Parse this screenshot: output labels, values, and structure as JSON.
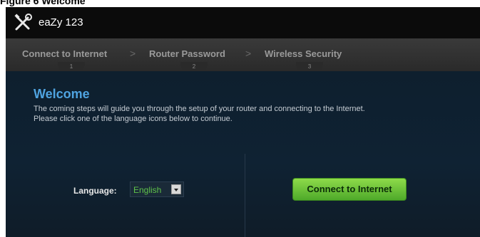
{
  "figure": {
    "caption": "Figure 6 Welcome"
  },
  "app": {
    "title": "eaZy 123",
    "logo_icon": "tools-icon"
  },
  "wizard": {
    "steps": [
      {
        "label": "Connect to Internet",
        "number": "1"
      },
      {
        "label": "Router Password",
        "number": "2"
      },
      {
        "label": "Wireless Security",
        "number": "3"
      }
    ],
    "separator": ">"
  },
  "welcome": {
    "title": "Welcome",
    "line1": "The coming steps will guide you through the setup of your router and connecting to the Internet.",
    "line2": "Please click one of the language icons below to continue."
  },
  "language": {
    "label": "Language:",
    "selected": "English"
  },
  "actions": {
    "connect_label": "Connect to Internet"
  },
  "colors": {
    "accent_blue": "#4fa3e0",
    "button_green": "#6cc43a",
    "language_green": "#5fc24a"
  }
}
